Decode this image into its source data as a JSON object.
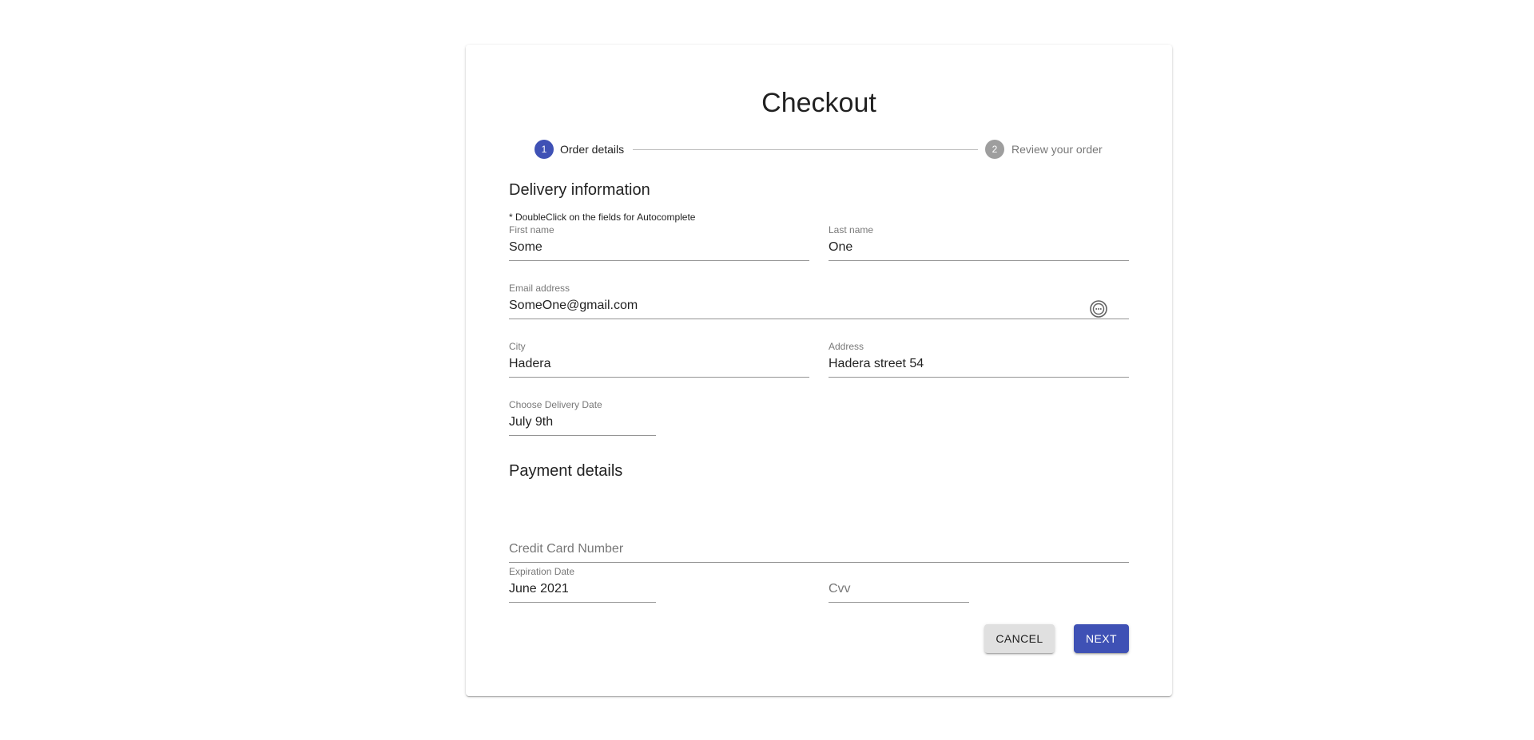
{
  "checkout": {
    "title": "Checkout"
  },
  "stepper": {
    "steps": [
      {
        "number": "1",
        "label": "Order details",
        "active": true
      },
      {
        "number": "2",
        "label": "Review your order",
        "active": false
      }
    ]
  },
  "delivery": {
    "section_title": "Delivery information",
    "hint": "* DoubleClick on the fields for Autocomplete",
    "first_name": {
      "label": "First name",
      "value": "Some"
    },
    "last_name": {
      "label": "Last name",
      "value": "One"
    },
    "email": {
      "label": "Email address",
      "value": "SomeOne@gmail.com",
      "icon": "account-circle-icon"
    },
    "city": {
      "label": "City",
      "value": "Hadera"
    },
    "address": {
      "label": "Address",
      "value": "Hadera street 54"
    },
    "delivery_date": {
      "label": "Choose Delivery Date",
      "value": "July 9th"
    }
  },
  "payment": {
    "section_title": "Payment details",
    "card_number": {
      "placeholder": "Credit Card Number"
    },
    "expiration": {
      "label": "Expiration Date",
      "value": "June 2021"
    },
    "cvv": {
      "placeholder": "Cvv"
    }
  },
  "actions": {
    "cancel_label": "CANCEL",
    "next_label": "NEXT"
  },
  "colors": {
    "primary": "#3f51b5",
    "inactive_step": "#9e9e9e",
    "cancel_bg": "#e0e0e0"
  }
}
